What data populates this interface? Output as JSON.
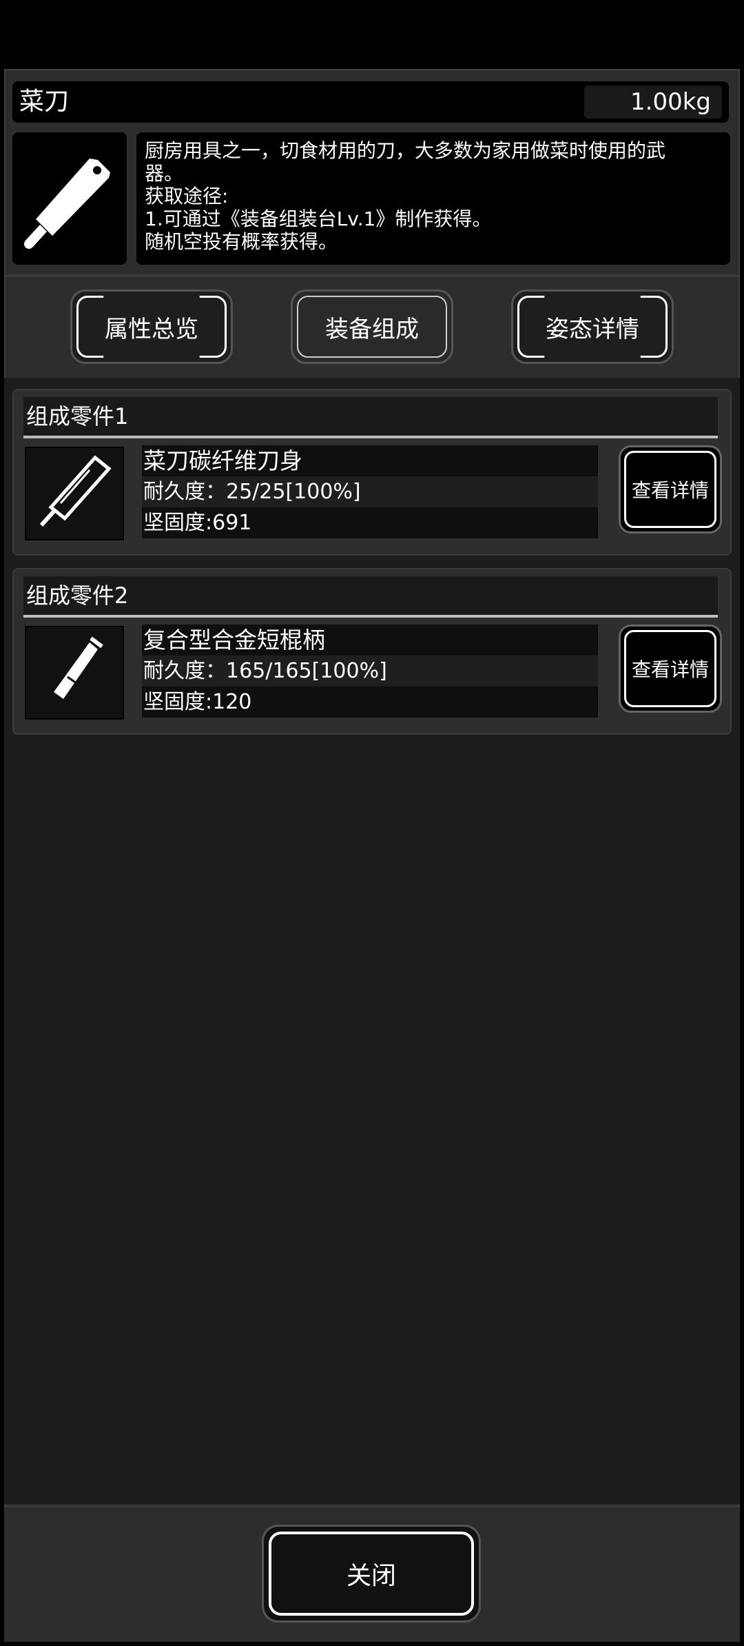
{
  "item": {
    "name": "菜刀",
    "weight": "1.00kg",
    "icon": "cleaver-icon",
    "description_lines": [
      "厨房用具之一，切食材用的刀，大多数为家用做菜时使用的武",
      "器。",
      "获取途径:",
      "1.可通过《装备组装台Lv.1》制作获得。",
      "随机空投有概率获得。"
    ]
  },
  "tabs": [
    {
      "label": "属性总览",
      "active": false
    },
    {
      "label": "装备组成",
      "active": true
    },
    {
      "label": "姿态详情",
      "active": false
    }
  ],
  "parts": [
    {
      "title": "组成零件1",
      "name": "菜刀碳纤维刀身",
      "durability": "耐久度：25/25[100%]",
      "hardness": "坚固度:691",
      "icon": "blade-icon",
      "button": "查看详情"
    },
    {
      "title": "组成零件2",
      "name": "复合型合金短棍柄",
      "durability": "耐久度：165/165[100%]",
      "hardness": "坚固度:120",
      "icon": "handle-icon",
      "button": "查看详情"
    }
  ],
  "footer": {
    "close_label": "关闭"
  }
}
